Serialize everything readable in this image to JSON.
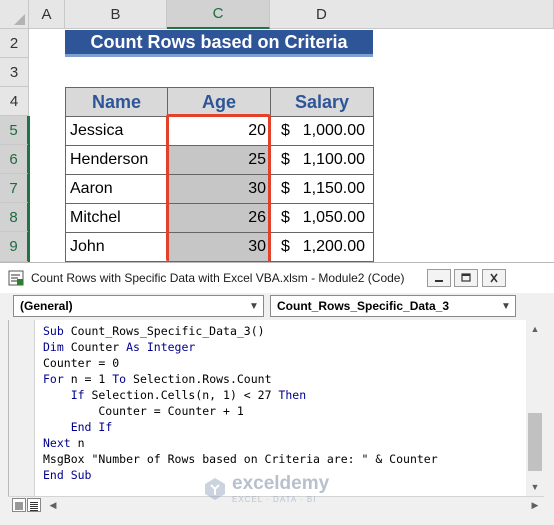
{
  "sheet": {
    "columns": [
      "A",
      "B",
      "C",
      "D"
    ],
    "rows": [
      "2",
      "3",
      "4",
      "5",
      "6",
      "7",
      "8",
      "9"
    ],
    "title": "Count Rows based on Criteria",
    "headers": {
      "name": "Name",
      "age": "Age",
      "salary": "Salary"
    },
    "records": [
      {
        "name": "Jessica",
        "age": "20",
        "currency": "$",
        "salary": "1,000.00"
      },
      {
        "name": "Henderson",
        "age": "25",
        "currency": "$",
        "salary": "1,100.00"
      },
      {
        "name": "Aaron",
        "age": "30",
        "currency": "$",
        "salary": "1,150.00"
      },
      {
        "name": "Mitchel",
        "age": "26",
        "currency": "$",
        "salary": "1,050.00"
      },
      {
        "name": "John",
        "age": "30",
        "currency": "$",
        "salary": "1,200.00"
      }
    ],
    "selection_color": "#e3412b",
    "header_fill": "#2e5597"
  },
  "vba": {
    "window_title": "Count Rows with Specific Data with Excel VBA.xlsm - Module2 (Code)",
    "object_combo": "(General)",
    "procedure_combo": "Count_Rows_Specific_Data_3",
    "code": [
      [
        {
          "t": "Sub ",
          "k": true
        },
        {
          "t": "Count_Rows_Specific_Data_3()"
        }
      ],
      [
        {
          "t": "Dim ",
          "k": true
        },
        {
          "t": "Counter "
        },
        {
          "t": "As Integer",
          "k": true
        }
      ],
      [
        {
          "t": "Counter = 0"
        }
      ],
      [
        {
          "t": "For ",
          "k": true
        },
        {
          "t": "n = 1 "
        },
        {
          "t": "To ",
          "k": true
        },
        {
          "t": "Selection.Rows.Count"
        }
      ],
      [
        {
          "t": "    "
        },
        {
          "t": "If ",
          "k": true
        },
        {
          "t": "Selection.Cells(n, 1) < 27 "
        },
        {
          "t": "Then",
          "k": true
        }
      ],
      [
        {
          "t": "        Counter = Counter + 1"
        }
      ],
      [
        {
          "t": "    "
        },
        {
          "t": "End If",
          "k": true
        }
      ],
      [
        {
          "t": "Next ",
          "k": true
        },
        {
          "t": "n"
        }
      ],
      [
        {
          "t": "MsgBox \"Number of Rows based on Criteria are: \" & Counter"
        }
      ],
      [
        {
          "t": "End Sub",
          "k": true
        }
      ]
    ],
    "keyword_color": "#00008b"
  },
  "watermark": {
    "name": "exceldemy",
    "tagline": "EXCEL · DATA · BI"
  }
}
